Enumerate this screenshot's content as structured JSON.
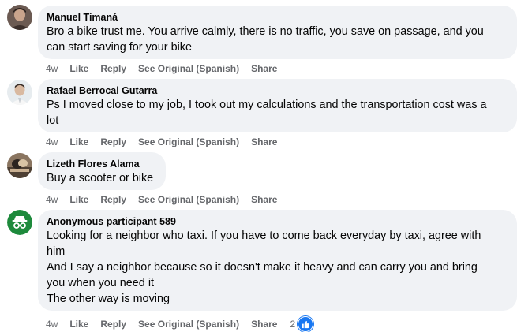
{
  "comments": [
    {
      "name": "Manuel Timaná",
      "lines": [
        "Bro a bike trust me. You arrive calmly, there is no traffic, you save on passage, and you",
        "can start saving for your bike"
      ],
      "time": "4w",
      "like": "Like",
      "reply": "Reply",
      "see_original": "See Original (Spanish)",
      "share": "Share"
    },
    {
      "name": "Rafael Berrocal Gutarra",
      "lines": [
        "Ps I moved close to my job, I took out my calculations and the transportation cost was a",
        "lot"
      ],
      "time": "4w",
      "like": "Like",
      "reply": "Reply",
      "see_original": "See Original (Spanish)",
      "share": "Share"
    },
    {
      "name": "Lizeth Flores Alama",
      "lines": [
        "Buy a scooter or bike"
      ],
      "time": "4w",
      "like": "Like",
      "reply": "Reply",
      "see_original": "See Original (Spanish)",
      "share": "Share"
    },
    {
      "name": "Anonymous participant 589",
      "lines": [
        "Looking for a neighbor who taxi. If you have to come back everyday by taxi, agree with",
        "him",
        "And I say a neighbor because so it doesn't make it heavy and can carry you and bring",
        "you when you need it",
        "The other way is moving"
      ],
      "time": "4w",
      "like": "Like",
      "reply": "Reply",
      "see_original": "See Original (Spanish)",
      "share": "Share",
      "reaction_count": "2"
    }
  ],
  "colors": {
    "bubble": "#f0f2f5",
    "meta_text": "#65676b",
    "like_blue": "#1877f2",
    "anon_green": "#1e8a3c"
  }
}
